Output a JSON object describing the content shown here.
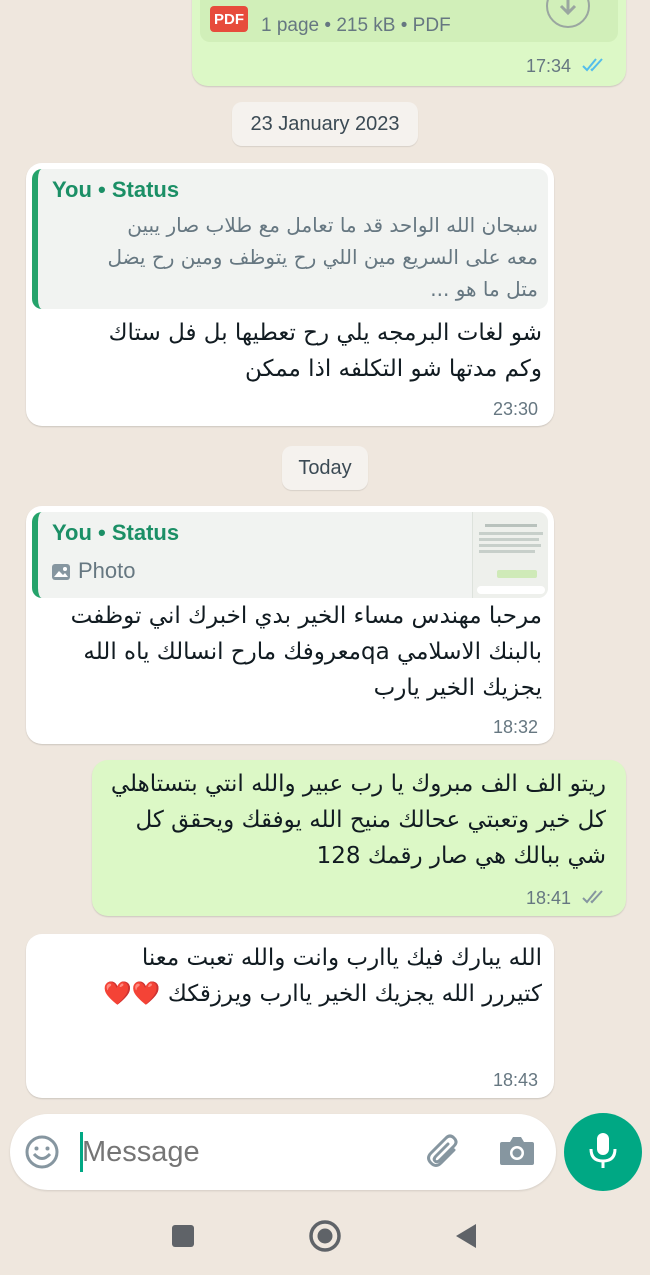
{
  "pdf_message": {
    "file_meta": "1 page • 215 kB • PDF",
    "pdf_badge": "PDF",
    "time": "17:34",
    "ticks": "read"
  },
  "dates": {
    "first": "23 January 2023",
    "second": "Today"
  },
  "messages": [
    {
      "direction": "incoming",
      "quote_author": "You • Status",
      "quote_text": "سبحان الله الواحد قد ما تعامل مع طلاب صار يبين معه على السريع مين اللي رح يتوظف ومين رح يضل متل ما هو ...",
      "text": "شو لغات البرمجه يلي رح تعطيها بل فل ستاك وكم مدتها شو التكلفه اذا ممكن",
      "time": "23:30"
    },
    {
      "direction": "incoming",
      "quote_author": "You • Status",
      "quote_text": "Photo",
      "text": "مرحبا مهندس مساء الخير بدي اخبرك اني توظفت بالبنك الاسلامي qaمعروفك مارح انسالك ياه الله يجزيك الخير يارب",
      "time": "18:32"
    },
    {
      "direction": "outgoing",
      "text": "ريتو الف الف مبروك يا رب عبير والله انتي بتستاهلي كل خير وتعبتي عحالك منيح الله يوفقك ويحقق كل شي ببالك هي صار رقمك 128",
      "time": "18:41",
      "ticks": "delivered"
    },
    {
      "direction": "incoming",
      "text": "الله يبارك فيك ياارب وانت والله تعبت معنا كتيررر الله يجزيك الخير ياارب ويرزقكك ❤️❤️",
      "time": "18:43"
    }
  ],
  "composer": {
    "placeholder": "Message"
  },
  "colors": {
    "chat_bg": "#efe7de",
    "outgoing_bubble": "#dcf8c6",
    "accent": "#00a884",
    "read_ticks": "#53bdeb"
  },
  "icons": [
    "download-icon",
    "pdf-icon",
    "photo-icon",
    "emoji-icon",
    "attach-icon",
    "camera-icon",
    "mic-icon",
    "nav-recent-icon",
    "nav-home-icon",
    "nav-back-icon"
  ]
}
